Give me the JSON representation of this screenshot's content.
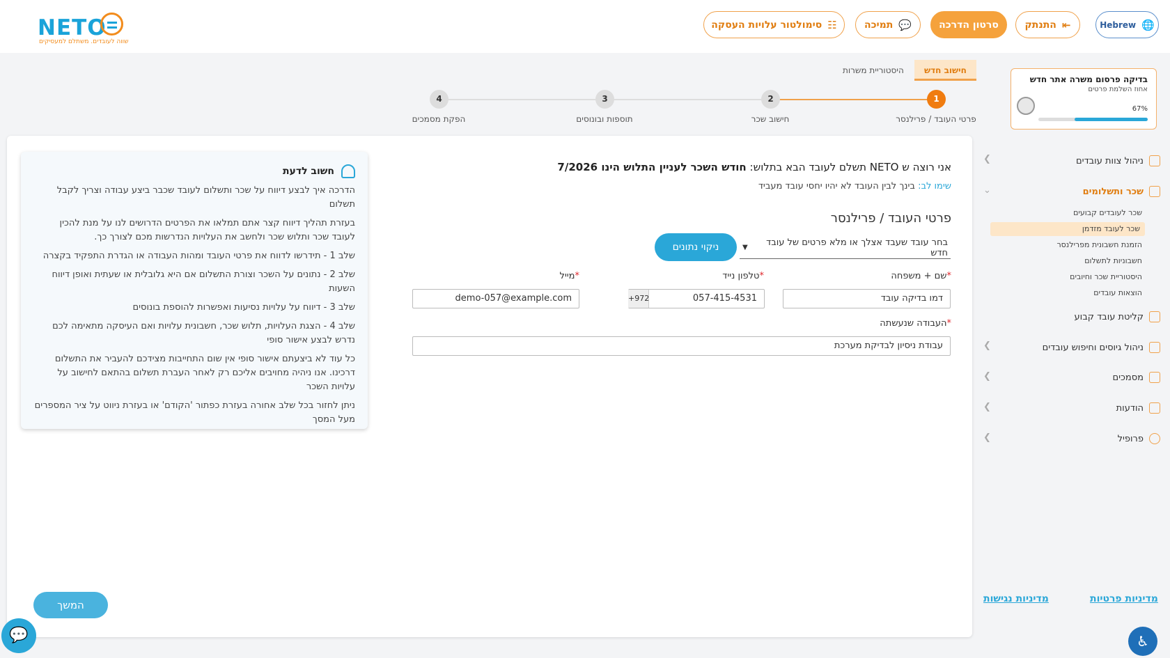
{
  "header": {
    "logo_text": "NETO",
    "logo_tagline": "שווה לעובדים. משתלם למעסיקים",
    "buttons": {
      "simulator": "סימולטור עלויות העסקה",
      "support": "תמיכה",
      "tutorial": "סרטון הדרכה",
      "logout": "התנתק",
      "language": "Hebrew"
    }
  },
  "progress_card": {
    "title": "בדיקה פרסום משרה אתר חדש",
    "subtitle": "אחוז השלמת פרטים",
    "percent_label": "67%",
    "percent_value": 0.67
  },
  "sidebar": {
    "items": [
      {
        "label": "ניהול צוות עובדים"
      },
      {
        "label": "שכר ותשלומים"
      },
      {
        "label": "קליטת עובד קבוע"
      },
      {
        "label": "ניהול גיוסים וחיפוש עובדים"
      },
      {
        "label": "מסמכים"
      },
      {
        "label": "הודעות"
      },
      {
        "label": "פרופיל"
      }
    ],
    "sub_items": [
      {
        "label": "שכר לעובדים קבועים"
      },
      {
        "label": "שכר לעובד מזדמן"
      },
      {
        "label": "הזמנת חשבונית מפרילנסר"
      },
      {
        "label": "חשבוניות לתשלום"
      },
      {
        "label": "היסטוריית שכר וחיובים"
      },
      {
        "label": "הוצאות עובדים"
      }
    ],
    "footer": {
      "privacy": "מדיניות פרטיות",
      "accessibility": "מדיניות נגישות"
    }
  },
  "tabs": [
    {
      "label": "חישוב חדש"
    },
    {
      "label": "היסטוריית משרות"
    }
  ],
  "stepper": [
    {
      "num": "1",
      "label": "פרטי העובד / פרילנסר"
    },
    {
      "num": "2",
      "label": "חישוב שכר"
    },
    {
      "num": "3",
      "label": "תוספות ובונוסים"
    },
    {
      "num": "4",
      "label": "הפקת מסמכים"
    }
  ],
  "info_box": {
    "title": "חשוב לדעת",
    "lines": [
      "הדרכה איך לבצע דיווח על שכר ותשלום לעובד שכבר ביצע עבודה וצריך לקבל תשלום",
      "בעזרת תהליך דיווח קצר אתם תמלאו את הפרטים הדרושים לנו על מנת להכין לעובד שכר ותלוש שכר ולחשב את העלויות הנדרשות מכם לצורך כך.",
      "שלב 1 - תידרשו לדווח את פרטי העובד ומהות העבודה או הגדרת התפקיד בקצרה",
      "שלב 2 - נתונים על השכר וצורת התשלום אם היא גלובלית או שעתית ואופן דיווח השעות",
      "שלב 3 - דיווח על עלויות נסיעות ואפשרות להוספת בונוסים",
      "שלב 4 - הצגת העלויות, תלוש שכר, חשבונית עלויות ואם העיסקה מתאימה לכם נדרש לבצע אישור סופי",
      "כל עוד לא ביצעתם אישור סופי אין שום התחייבות מצידכם להעביר את התשלום דרכינו. אנו ניהיה מחויבים אליכם רק לאחר העברת תשלום בהתאם לחישוב על עלויות השכר",
      "ניתן לחזור בכל שלב אחורה בעזרת כפתור 'הקודם' או בעזרת ניווט על ציר המספרים מעל המסך"
    ]
  },
  "form": {
    "heading_prefix": "אני רוצה ש NETO תשלם לעובד הבא בתלוש:",
    "heading_bold": "חודש השכר לעניין התלוש הינו 7/2026",
    "note_label": "שימו לב:",
    "note_text": "בינך לבין העובד לא יהיו יחסי עובד מעביד",
    "section_title": "פרטי העובד / פרילנסר",
    "employee_select": "בחר עובד שעבד אצלך או מלא פרטים של עובד חדש",
    "clear_button": "ניקוי נתונים",
    "full_name_label": "שם + משפחה",
    "full_name_value": "דמו בדיקה עובד",
    "phone_label": "טלפון נייד",
    "phone_prefix": "+972",
    "phone_value": "057-415-4531",
    "email_label": "מייל",
    "email_value": "demo-057@example.com",
    "work_label": "העבודה שנעשתה",
    "work_value": "עבודת ניסיון לבדיקת מערכת",
    "required_mark": "*",
    "next_button": "המשך"
  }
}
